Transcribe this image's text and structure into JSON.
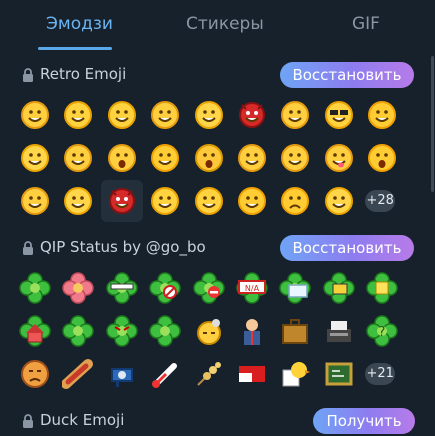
{
  "tabs": [
    {
      "label": "Эмодзи",
      "active": true
    },
    {
      "label": "Стикеры",
      "active": false
    },
    {
      "label": "GIF",
      "active": false
    }
  ],
  "sections": [
    {
      "title": "Retro Emoji",
      "action": "Восстановить",
      "more": "+28",
      "icons": [
        "grinning-face-icon",
        "laughing-face-icon",
        "crying-laughing-face-icon",
        "thumbs-up-face-icon",
        "smiling-face-icon",
        "red-devil-face-icon",
        "grimacing-face-icon",
        "sunglasses-face-icon",
        "sleepy-face-icon",
        "wink-face-icon",
        "waving-face-icon",
        "surprised-face-icon",
        "kissing-face-icon",
        "scream-face-icon",
        "hands-face-icon",
        "hiding-face-icon",
        "tongue-face-icon",
        "shocked-face-icon",
        "smirk-face-icon",
        "sleeping-face-icon",
        "angry-devil-icon",
        "laughing-face-2-icon",
        "thumbs-face-icon",
        "thinking-face-icon",
        "worried-face-icon",
        "sleeping-face-2-icon"
      ]
    },
    {
      "title": "QIP Status by @go_bo",
      "action": "Восстановить",
      "more": "+21",
      "icons": [
        "clover-online-icon",
        "clover-pink-icon",
        "clover-glasses-icon",
        "clover-away-icon",
        "clover-busy-icon",
        "clover-na-sign-icon",
        "clover-envelope-icon",
        "clover-computer-icon",
        "clover-phone-icon",
        "clover-house-icon",
        "clover-sleep-icon",
        "clover-angry-icon",
        "clover-happy-icon",
        "sleeping-bulb-face-icon",
        "businessman-icon",
        "briefcase-icon",
        "typewriter-icon",
        "clover-question-icon",
        "sad-face-icon",
        "hotdog-icon",
        "camera-icon",
        "thermometer-icon",
        "skewer-icon",
        "pill-icon",
        "duck-cup-icon",
        "chalkboard-icon"
      ]
    },
    {
      "title": "Duck Emoji",
      "action": "Получить"
    }
  ],
  "colors": {
    "background": "#17212b",
    "accent": "#6bb4f2",
    "pill_start": "#6fa4f5",
    "pill_end": "#b77be8",
    "clover": "#3fbf3f"
  }
}
